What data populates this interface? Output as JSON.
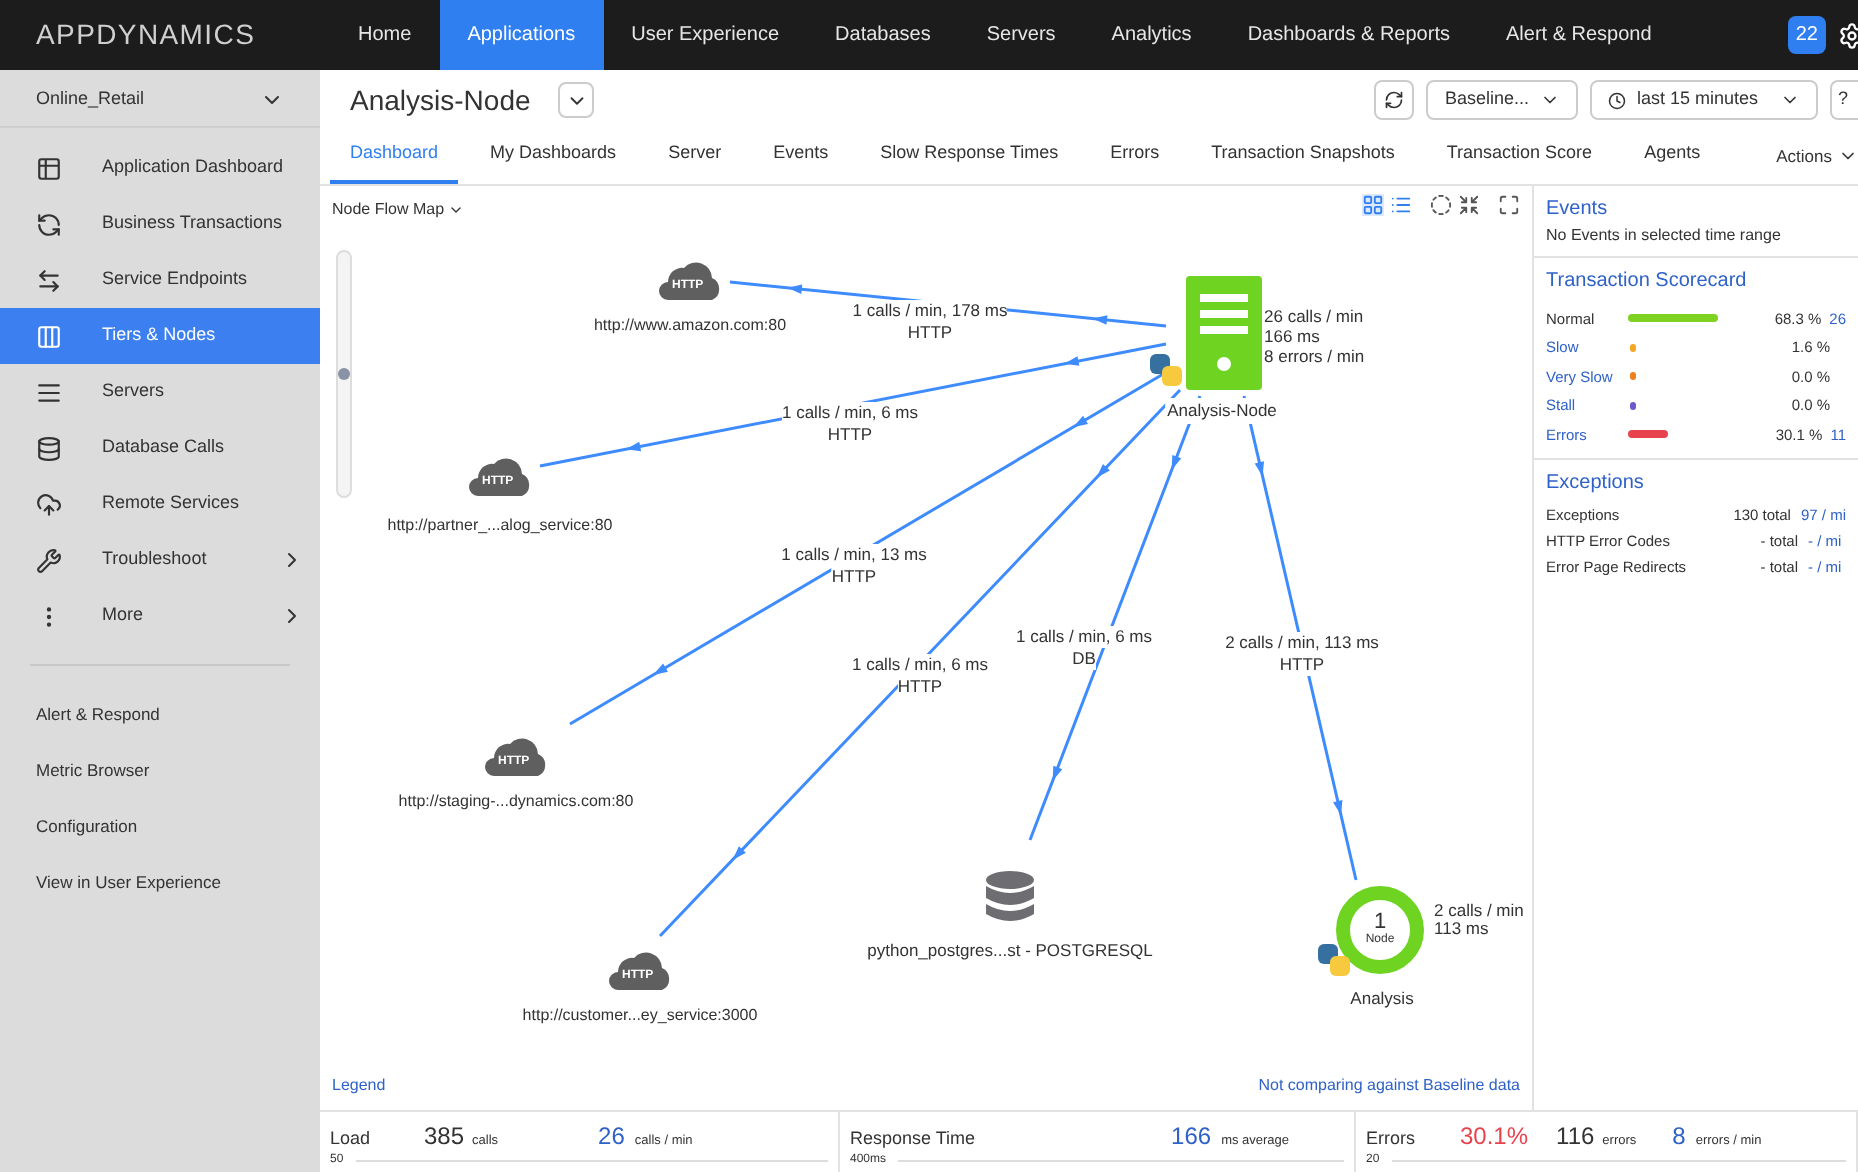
{
  "brand": "APPDYNAMICS",
  "nav": [
    {
      "label": "Home",
      "selected": false
    },
    {
      "label": "Applications",
      "selected": true
    },
    {
      "label": "User Experience",
      "selected": false
    },
    {
      "label": "Databases",
      "selected": false
    },
    {
      "label": "Servers",
      "selected": false
    },
    {
      "label": "Analytics",
      "selected": false
    },
    {
      "label": "Dashboards & Reports",
      "selected": false
    },
    {
      "label": "Alert & Respond",
      "selected": false
    }
  ],
  "notification_count": "22",
  "sidebar": {
    "app": "Online_Retail",
    "items": [
      {
        "label": "Application Dashboard",
        "selected": false,
        "submenu": false
      },
      {
        "label": "Business Transactions",
        "selected": false,
        "submenu": false
      },
      {
        "label": "Service Endpoints",
        "selected": false,
        "submenu": false
      },
      {
        "label": "Tiers & Nodes",
        "selected": true,
        "submenu": false
      },
      {
        "label": "Servers",
        "selected": false,
        "submenu": false
      },
      {
        "label": "Database Calls",
        "selected": false,
        "submenu": false
      },
      {
        "label": "Remote Services",
        "selected": false,
        "submenu": false
      },
      {
        "label": "Troubleshoot",
        "selected": false,
        "submenu": true
      },
      {
        "label": "More",
        "selected": false,
        "submenu": true
      }
    ],
    "links": [
      "Alert & Respond",
      "Metric Browser",
      "Configuration",
      "View in User Experience"
    ]
  },
  "header": {
    "title": "Analysis-Node",
    "baseline": "Baseline...",
    "time_range": "last 15 minutes",
    "help": "?"
  },
  "tabs": [
    {
      "label": "Dashboard",
      "selected": true
    },
    {
      "label": "My Dashboards",
      "selected": false
    },
    {
      "label": "Server",
      "selected": false
    },
    {
      "label": "Events",
      "selected": false
    },
    {
      "label": "Slow Response Times",
      "selected": false
    },
    {
      "label": "Errors",
      "selected": false
    },
    {
      "label": "Transaction Snapshots",
      "selected": false
    },
    {
      "label": "Transaction Score",
      "selected": false
    },
    {
      "label": "Agents",
      "selected": false
    }
  ],
  "actions": "Actions",
  "flow_map": {
    "title": "Node Flow Map",
    "zoom": {
      "level": 0.5
    },
    "remote": [
      {
        "type": "HTTP",
        "label": "http://www.amazon.com:80"
      },
      {
        "type": "HTTP",
        "label": "http://partner_...alog_service:80"
      },
      {
        "type": "HTTP",
        "label": "http://staging-...dynamics.com:80"
      },
      {
        "type": "HTTP",
        "label": "http://customer...ey_service:3000"
      }
    ],
    "database": {
      "label": "python_postgres...st - POSTGRESQL"
    },
    "node": {
      "label": "Analysis-Node",
      "stats": [
        "26 calls / min",
        "166 ms",
        "8 errors / min"
      ]
    },
    "tier": {
      "count": "1",
      "unit": "Node",
      "label": "Analysis",
      "stats": [
        "2 calls / min",
        "113 ms"
      ]
    },
    "edges": [
      {
        "label": "1 calls / min, 178 ms",
        "protocol": "HTTP"
      },
      {
        "label": "1 calls / min, 6 ms",
        "protocol": "HTTP"
      },
      {
        "label": "1 calls / min, 13 ms",
        "protocol": "HTTP"
      },
      {
        "label": "1 calls / min, 6 ms",
        "protocol": "HTTP"
      },
      {
        "label": "1 calls / min, 6 ms",
        "protocol": "DB"
      },
      {
        "label": "2 calls / min, 113 ms",
        "protocol": "HTTP"
      }
    ],
    "legend": "Legend",
    "baseline_note": "Not comparing against Baseline data"
  },
  "events": {
    "title": "Events",
    "text": "No Events in selected time range"
  },
  "scorecard": {
    "title": "Transaction Scorecard",
    "rows": [
      {
        "name": "Normal",
        "link": false,
        "kind": "bar",
        "color": "#7ed321",
        "percent": "68.3 %",
        "count": "26"
      },
      {
        "name": "Slow",
        "link": true,
        "kind": "dot",
        "color": "#f5a623",
        "percent": "1.6 %"
      },
      {
        "name": "Very Slow",
        "link": true,
        "kind": "dot",
        "color": "#f07f1f",
        "percent": "0.0 %"
      },
      {
        "name": "Stall",
        "link": true,
        "kind": "dot",
        "color": "#6a5acd",
        "percent": "0.0 %"
      },
      {
        "name": "Errors",
        "link": true,
        "kind": "short_bar",
        "color": "#e8424e",
        "percent": "30.1 %",
        "count": "11"
      }
    ]
  },
  "exceptions": {
    "title": "Exceptions",
    "rows": [
      {
        "name": "Exceptions",
        "total": "130 total",
        "rate": "97 / mi"
      },
      {
        "name": "HTTP Error Codes",
        "total": "- total",
        "rate": "- / mi"
      },
      {
        "name": "Error Page Redirects",
        "total": "- total",
        "rate": "- / mi"
      }
    ]
  },
  "stats": [
    {
      "title": "Load",
      "value": "385",
      "unit": "calls",
      "value2": "26",
      "unit2": "calls / min",
      "tick": "50"
    },
    {
      "title": "Response Time",
      "value2": "166",
      "unit2": "ms average",
      "tick": "400ms"
    },
    {
      "title": "Errors",
      "value": "30.1%",
      "alert": true,
      "value2_plain": "116",
      "unit_plain": "errors",
      "value2": "8",
      "unit2": "errors / min",
      "tick": "20"
    }
  ]
}
